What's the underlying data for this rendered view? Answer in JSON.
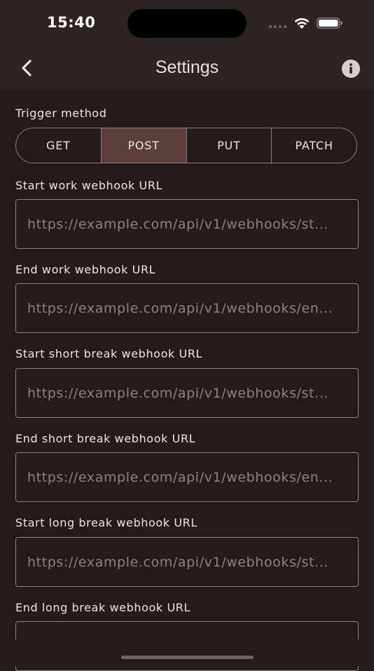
{
  "status_bar": {
    "time": "15:40"
  },
  "nav": {
    "title": "Settings",
    "back_icon": "chevron-left-icon",
    "info_icon": "info-circle-icon"
  },
  "trigger": {
    "label": "Trigger method",
    "options": [
      "GET",
      "POST",
      "PUT",
      "PATCH"
    ],
    "selected": "POST"
  },
  "fields": [
    {
      "label": "Start work webhook URL",
      "placeholder": "https://example.com/api/v1/webhooks/st..."
    },
    {
      "label": "End work webhook URL",
      "placeholder": "https://example.com/api/v1/webhooks/en..."
    },
    {
      "label": "Start short break webhook URL",
      "placeholder": "https://example.com/api/v1/webhooks/st..."
    },
    {
      "label": "End short break webhook URL",
      "placeholder": "https://example.com/api/v1/webhooks/en..."
    },
    {
      "label": "Start long break webhook URL",
      "placeholder": "https://example.com/api/v1/webhooks/st..."
    },
    {
      "label": "End long break webhook URL",
      "placeholder": ""
    }
  ],
  "colors": {
    "background": "#231c1b",
    "header": "#2e2523",
    "selected_segment": "#5e3e3b",
    "border": "#8b807c"
  }
}
